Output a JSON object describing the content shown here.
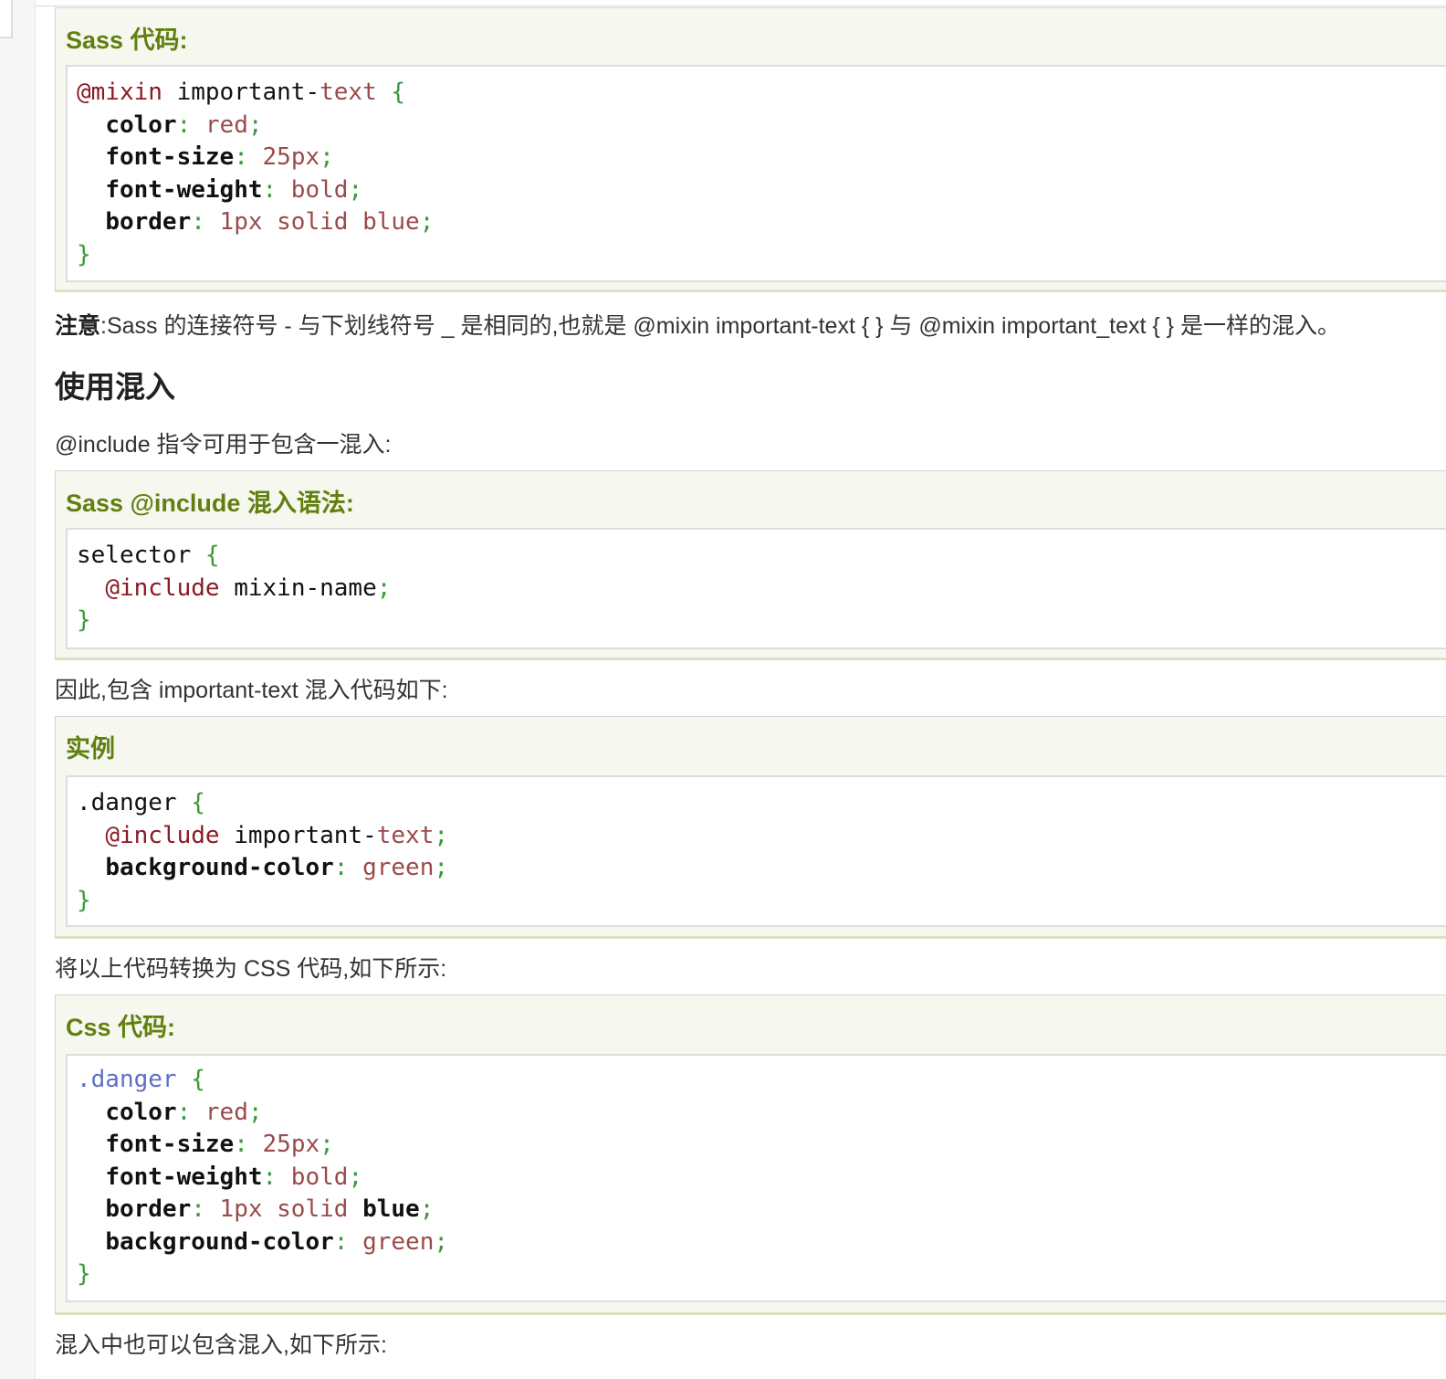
{
  "examples": {
    "sass_code": {
      "title": "Sass 代码:",
      "lines": [
        [
          {
            "t": "@mixin",
            "c": "at"
          },
          {
            "t": " important-",
            "c": "plain"
          },
          {
            "t": "text",
            "c": "val"
          },
          {
            "t": " ",
            "c": "plain"
          },
          {
            "t": "{",
            "c": "br"
          }
        ],
        [
          {
            "t": "  ",
            "c": "plain"
          },
          {
            "t": "color",
            "c": "prop"
          },
          {
            "t": ":",
            "c": "pt"
          },
          {
            "t": " red",
            "c": "val"
          },
          {
            "t": ";",
            "c": "pt"
          }
        ],
        [
          {
            "t": "  ",
            "c": "plain"
          },
          {
            "t": "font-size",
            "c": "prop"
          },
          {
            "t": ":",
            "c": "pt"
          },
          {
            "t": " 25px",
            "c": "val"
          },
          {
            "t": ";",
            "c": "pt"
          }
        ],
        [
          {
            "t": "  ",
            "c": "plain"
          },
          {
            "t": "font-weight",
            "c": "prop"
          },
          {
            "t": ":",
            "c": "pt"
          },
          {
            "t": " bold",
            "c": "val"
          },
          {
            "t": ";",
            "c": "pt"
          }
        ],
        [
          {
            "t": "  ",
            "c": "plain"
          },
          {
            "t": "border",
            "c": "prop"
          },
          {
            "t": ":",
            "c": "pt"
          },
          {
            "t": " 1px solid blue",
            "c": "val"
          },
          {
            "t": ";",
            "c": "pt"
          }
        ],
        [
          {
            "t": "}",
            "c": "br"
          }
        ]
      ]
    },
    "include_syntax": {
      "title": "Sass @include 混入语法:",
      "lines": [
        [
          {
            "t": "selector ",
            "c": "plain"
          },
          {
            "t": "{",
            "c": "br"
          }
        ],
        [
          {
            "t": "  ",
            "c": "plain"
          },
          {
            "t": "@include",
            "c": "at"
          },
          {
            "t": " mixin-name",
            "c": "plain"
          },
          {
            "t": ";",
            "c": "pt"
          }
        ],
        [
          {
            "t": "}",
            "c": "br"
          }
        ]
      ]
    },
    "instance": {
      "title": "实例",
      "lines": [
        [
          {
            "t": ".danger ",
            "c": "plain"
          },
          {
            "t": "{",
            "c": "br"
          }
        ],
        [
          {
            "t": "  ",
            "c": "plain"
          },
          {
            "t": "@include",
            "c": "at"
          },
          {
            "t": " important-",
            "c": "plain"
          },
          {
            "t": "text",
            "c": "val"
          },
          {
            "t": ";",
            "c": "pt"
          }
        ],
        [
          {
            "t": "  ",
            "c": "plain"
          },
          {
            "t": "background-color",
            "c": "prop"
          },
          {
            "t": ":",
            "c": "pt"
          },
          {
            "t": " green",
            "c": "val"
          },
          {
            "t": ";",
            "c": "pt"
          }
        ],
        [
          {
            "t": "}",
            "c": "br"
          }
        ]
      ]
    },
    "css_code": {
      "title": "Css 代码:",
      "lines": [
        [
          {
            "t": ".danger",
            "c": "sel"
          },
          {
            "t": " ",
            "c": "plain"
          },
          {
            "t": "{",
            "c": "br"
          }
        ],
        [
          {
            "t": "  ",
            "c": "plain"
          },
          {
            "t": "color",
            "c": "prop"
          },
          {
            "t": ":",
            "c": "pt"
          },
          {
            "t": " red",
            "c": "val"
          },
          {
            "t": ";",
            "c": "pt"
          }
        ],
        [
          {
            "t": "  ",
            "c": "plain"
          },
          {
            "t": "font-size",
            "c": "prop"
          },
          {
            "t": ":",
            "c": "pt"
          },
          {
            "t": " 25px",
            "c": "val"
          },
          {
            "t": ";",
            "c": "pt"
          }
        ],
        [
          {
            "t": "  ",
            "c": "plain"
          },
          {
            "t": "font-weight",
            "c": "prop"
          },
          {
            "t": ":",
            "c": "pt"
          },
          {
            "t": " bold",
            "c": "val"
          },
          {
            "t": ";",
            "c": "pt"
          }
        ],
        [
          {
            "t": "  ",
            "c": "plain"
          },
          {
            "t": "border",
            "c": "prop"
          },
          {
            "t": ":",
            "c": "pt"
          },
          {
            "t": " 1px solid ",
            "c": "val"
          },
          {
            "t": "blue",
            "c": "prop"
          },
          {
            "t": ";",
            "c": "pt"
          }
        ],
        [
          {
            "t": "  ",
            "c": "plain"
          },
          {
            "t": "background-color",
            "c": "prop"
          },
          {
            "t": ":",
            "c": "pt"
          },
          {
            "t": " green",
            "c": "val"
          },
          {
            "t": ";",
            "c": "pt"
          }
        ],
        [
          {
            "t": "}",
            "c": "br"
          }
        ]
      ]
    }
  },
  "note": {
    "label": "注意",
    "text": ":Sass 的连接符号 - 与下划线符号 _ 是相同的,也就是 @mixin important-text { } 与 @mixin important_text { } 是一样的混入。"
  },
  "heading_use_mixin": "使用混入",
  "para_include": "@include 指令可用于包含一混入:",
  "para_therefore": "因此,包含 important-text 混入代码如下:",
  "para_convert": "将以上代码转换为 CSS 代码,如下所示:",
  "para_nested": "混入中也可以包含混入,如下所示:",
  "colors": {
    "example_title": "#617f10",
    "example_bg": "#f6f8ef",
    "at_rule": "#8b1a24",
    "value": "#9b4a4a",
    "brace": "#3a9a3a",
    "selector": "#5f6fc6"
  }
}
